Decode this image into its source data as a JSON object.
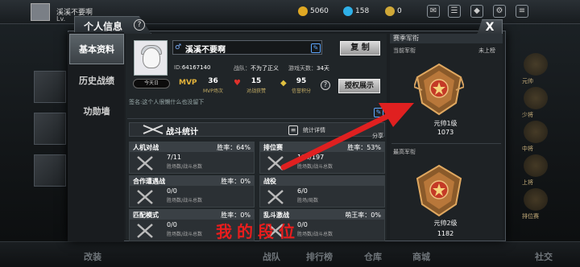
{
  "topbar": {
    "player_name": "溪溪不要啊",
    "level": "Lv.",
    "currency_1": "5060",
    "currency_2": "158",
    "currency_3": "0"
  },
  "bottom_nav": [
    "改装",
    "战队",
    "排行榜",
    "仓库",
    "商城",
    "社交"
  ],
  "bg_ranks": [
    "元帅",
    "少将",
    "中将",
    "上将",
    "排位赛"
  ],
  "dialog": {
    "title": "个人信息",
    "help": "?",
    "close": "X"
  },
  "tabs": [
    "基本资料",
    "历史战绩",
    "功勋墙"
  ],
  "profile": {
    "name": "溪溪不要啊",
    "gender_icon": "♂",
    "copy_button": "复 制",
    "id_label": "ID:",
    "id_value": "64167140",
    "team_label": "战队：",
    "team_value": "不为了正义",
    "days_label": "游戏天数：",
    "days_value": "34天",
    "vip_label": "今天日",
    "mvp_icon": "MVP",
    "mvp_value": "36",
    "mvp_label": "MVP场次",
    "heart_value": "15",
    "heart_label": "对战获赞",
    "credit_value": "95",
    "credit_label": "信誉积分",
    "show_button": "授权展示",
    "signature": "签名:这个人很懒什么也没留下"
  },
  "battle": {
    "title": "战斗统计",
    "detail_link": "统计详情",
    "share": "分享",
    "cells": [
      {
        "title": "人机对战",
        "rate": "胜率：64%",
        "value": "7/11",
        "sub": "胜场数/战斗总数"
      },
      {
        "title": "排位赛",
        "rate": "胜率：53%",
        "value": "104/197",
        "sub": "胜场数/战斗总数"
      },
      {
        "title": "合作遭遇战",
        "rate": "胜率：0%",
        "value": "0/0",
        "sub": "胜场数/战斗总数"
      },
      {
        "title": "战役",
        "rate": "",
        "value": "6/0",
        "sub": "胜场/局数"
      },
      {
        "title": "匹配模式",
        "rate": "胜率：0%",
        "value": "0/0",
        "sub": "胜场数/战斗总数"
      },
      {
        "title": "乱斗激战",
        "rate": "萌王率：0%",
        "value": "0/0",
        "sub": "胜场数/战斗总数"
      }
    ]
  },
  "rank": {
    "header": "赛季军衔",
    "current_label": "当前军衔",
    "current_status": "未上榜",
    "current_name": "元帅1级",
    "current_score": "1073",
    "best_label": "最高军衔",
    "best_name": "元帅2级",
    "best_score": "1182"
  },
  "overlay": {
    "text": "我的段位",
    "color": "#e81d1d"
  }
}
